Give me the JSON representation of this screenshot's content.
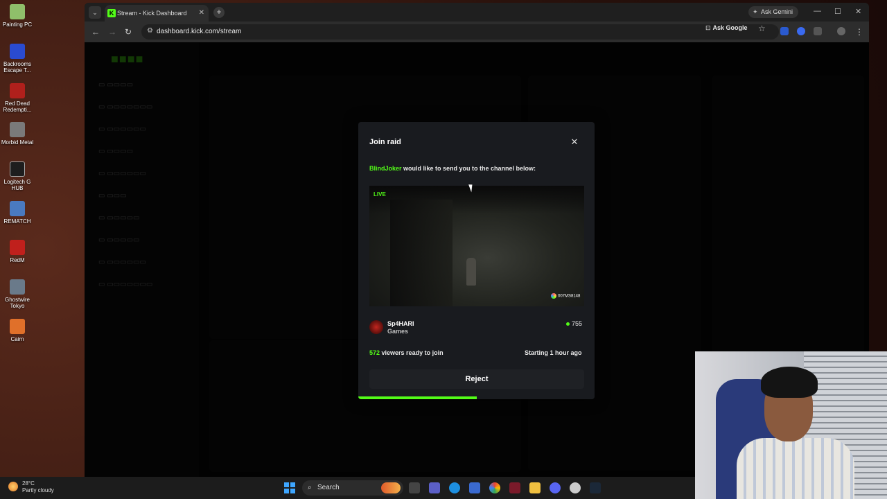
{
  "desktop": {
    "icons": [
      {
        "label": "Painting PC",
        "color": "#8fbf6a"
      },
      {
        "label": "Backrooms Escape T...",
        "color": "#2a4bd0"
      },
      {
        "label": "Red Dead Redempti...",
        "color": "#b0201c"
      },
      {
        "label": "Morbid Metal",
        "color": "#7a7a7a"
      },
      {
        "label": "Logitech G HUB",
        "color": "#1e1e1e"
      },
      {
        "label": "REMATCH",
        "color": "#4a7ac0"
      },
      {
        "label": "RedM",
        "color": "#c0201c"
      },
      {
        "label": "Ghostwire Tokyo",
        "color": "#6a7a8a"
      },
      {
        "label": "Cairn",
        "color": "#e0702a"
      }
    ]
  },
  "browser": {
    "tab_title": "Stream - Kick Dashboard",
    "tab_favicon": "K",
    "gemini_label": "Ask Gemini",
    "url": "dashboard.kick.com/stream",
    "ask_google": "Ask Google"
  },
  "modal": {
    "title": "Join raid",
    "raider": "BlindJoker",
    "raid_message": " would like to send you to the channel below:",
    "live_label": "LIVE",
    "channel_overlay": "007MS8148",
    "streamer_name": "Sp4HARI",
    "streamer_category": "Games",
    "viewer_count": "755",
    "viewers_ready_count": "572",
    "viewers_ready_text": " viewers ready to join",
    "starting_text": "Starting 1 hour ago",
    "reject_label": "Reject",
    "progress_fraction": 0.5
  },
  "taskbar": {
    "weather_temp": "28°C",
    "weather_condition": "Partly cloudy",
    "search_label": "Search"
  },
  "colors": {
    "kick_green": "#53fc18",
    "modal_bg": "#191b1f"
  }
}
